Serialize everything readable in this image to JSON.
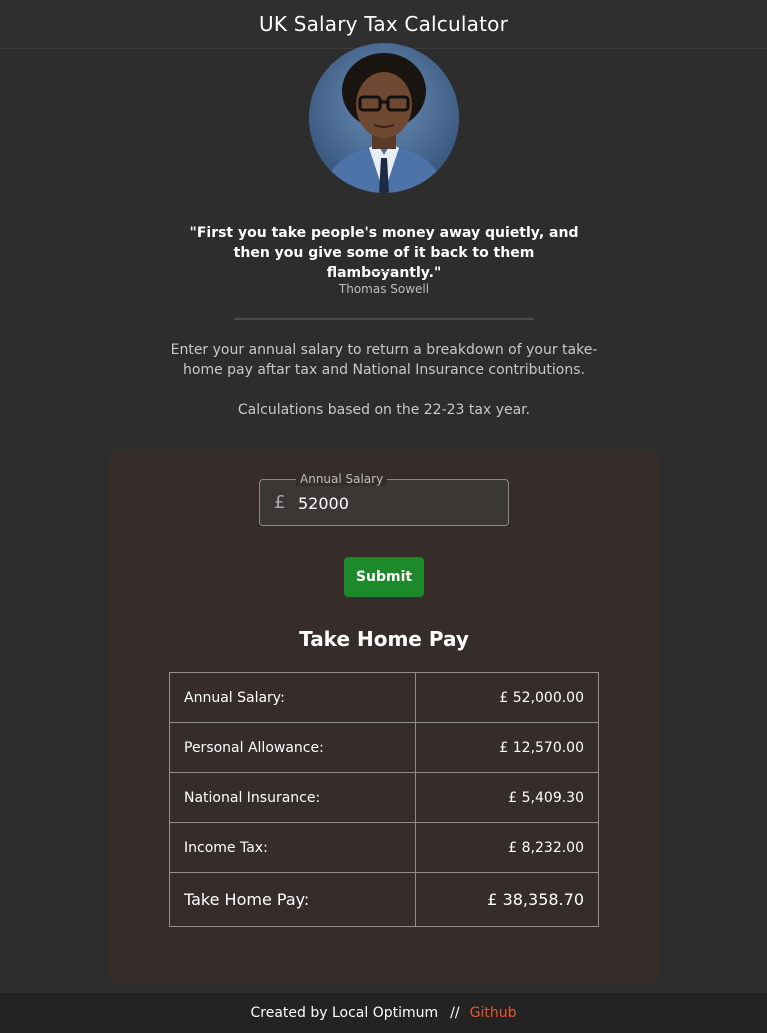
{
  "header": {
    "title": "UK Salary Tax Calculator"
  },
  "portrait": {
    "icon": "person-portrait"
  },
  "quote": {
    "text": "\"First you take people's money away quietly, and then you give some of it back to them flamboyantly.\"",
    "author": "Thomas Sowell"
  },
  "intro": {
    "text": "Enter your annual salary to return a breakdown of your take-home pay aftar tax and National Insurance contributions.",
    "tax_year": "Calculations based on the 22-23 tax year."
  },
  "form": {
    "salary_label": "Annual Salary",
    "currency_symbol": "£",
    "salary_value": "52000",
    "submit_label": "Submit"
  },
  "results": {
    "title": "Take Home Pay",
    "rows": [
      {
        "label": "Annual Salary:",
        "value": "£ 52,000.00"
      },
      {
        "label": "Personal Allowance:",
        "value": "£ 12,570.00"
      },
      {
        "label": "National Insurance:",
        "value": "£ 5,409.30"
      },
      {
        "label": "Income Tax:",
        "value": "£ 8,232.00"
      },
      {
        "label": "Take Home Pay:",
        "value": "£ 38,358.70"
      }
    ]
  },
  "footer": {
    "credit": "Created by Local Optimum",
    "separator": "//",
    "link_label": "Github"
  },
  "colors": {
    "background": "#2d2d2d",
    "card": "#362d2a",
    "submit": "#1c8a2a",
    "link": "#e8582a"
  }
}
